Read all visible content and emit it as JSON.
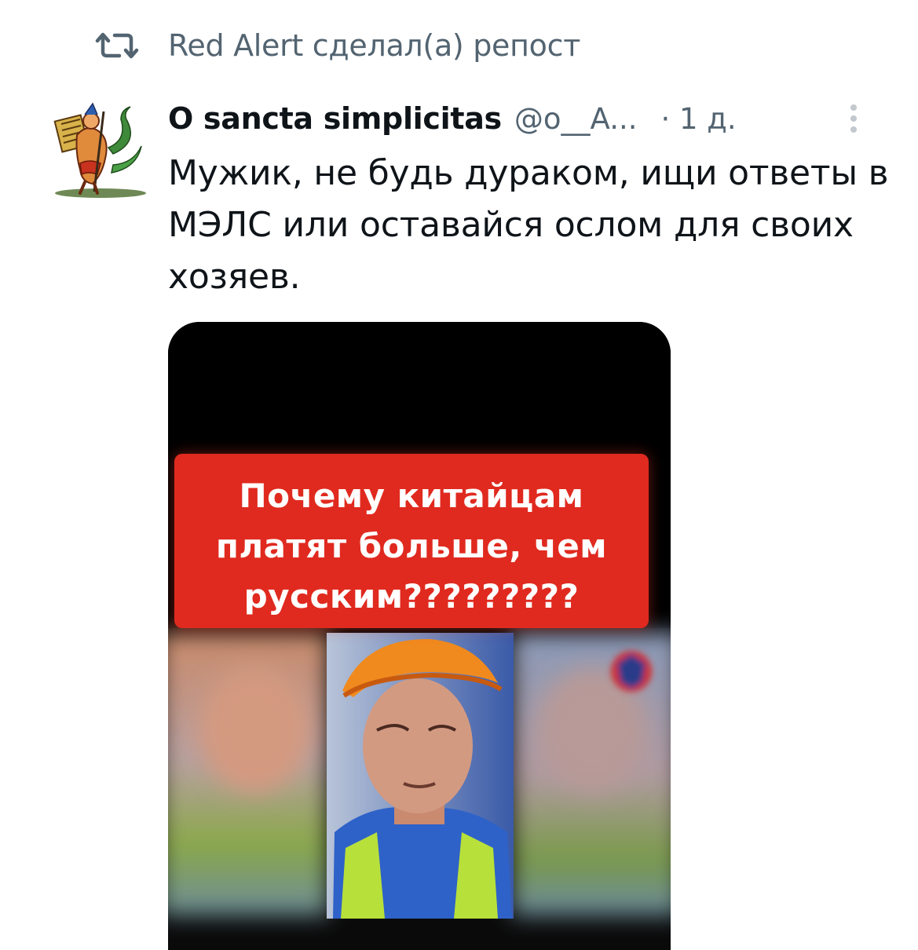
{
  "repost": {
    "icon": "repost-icon",
    "text": "Red Alert сделал(а) репост"
  },
  "tweet": {
    "avatar_icon": "avatar-illustration",
    "display_name": "O sancta simplicitas",
    "handle": "@o__A...",
    "time": "· 1 д.",
    "more_icon": "more-vertical-icon",
    "text": "Мужик, не будь дураком, ищи ответы в МЭЛС или оставайся ослом для своих хозяев."
  },
  "media": {
    "caption": "Почему китайцам\nплатят больше, чем\nрусским?????????",
    "caption_color": "#e02a1f"
  },
  "colors": {
    "text_primary": "#0f1419",
    "text_secondary": "#536471",
    "background": "#ffffff"
  }
}
